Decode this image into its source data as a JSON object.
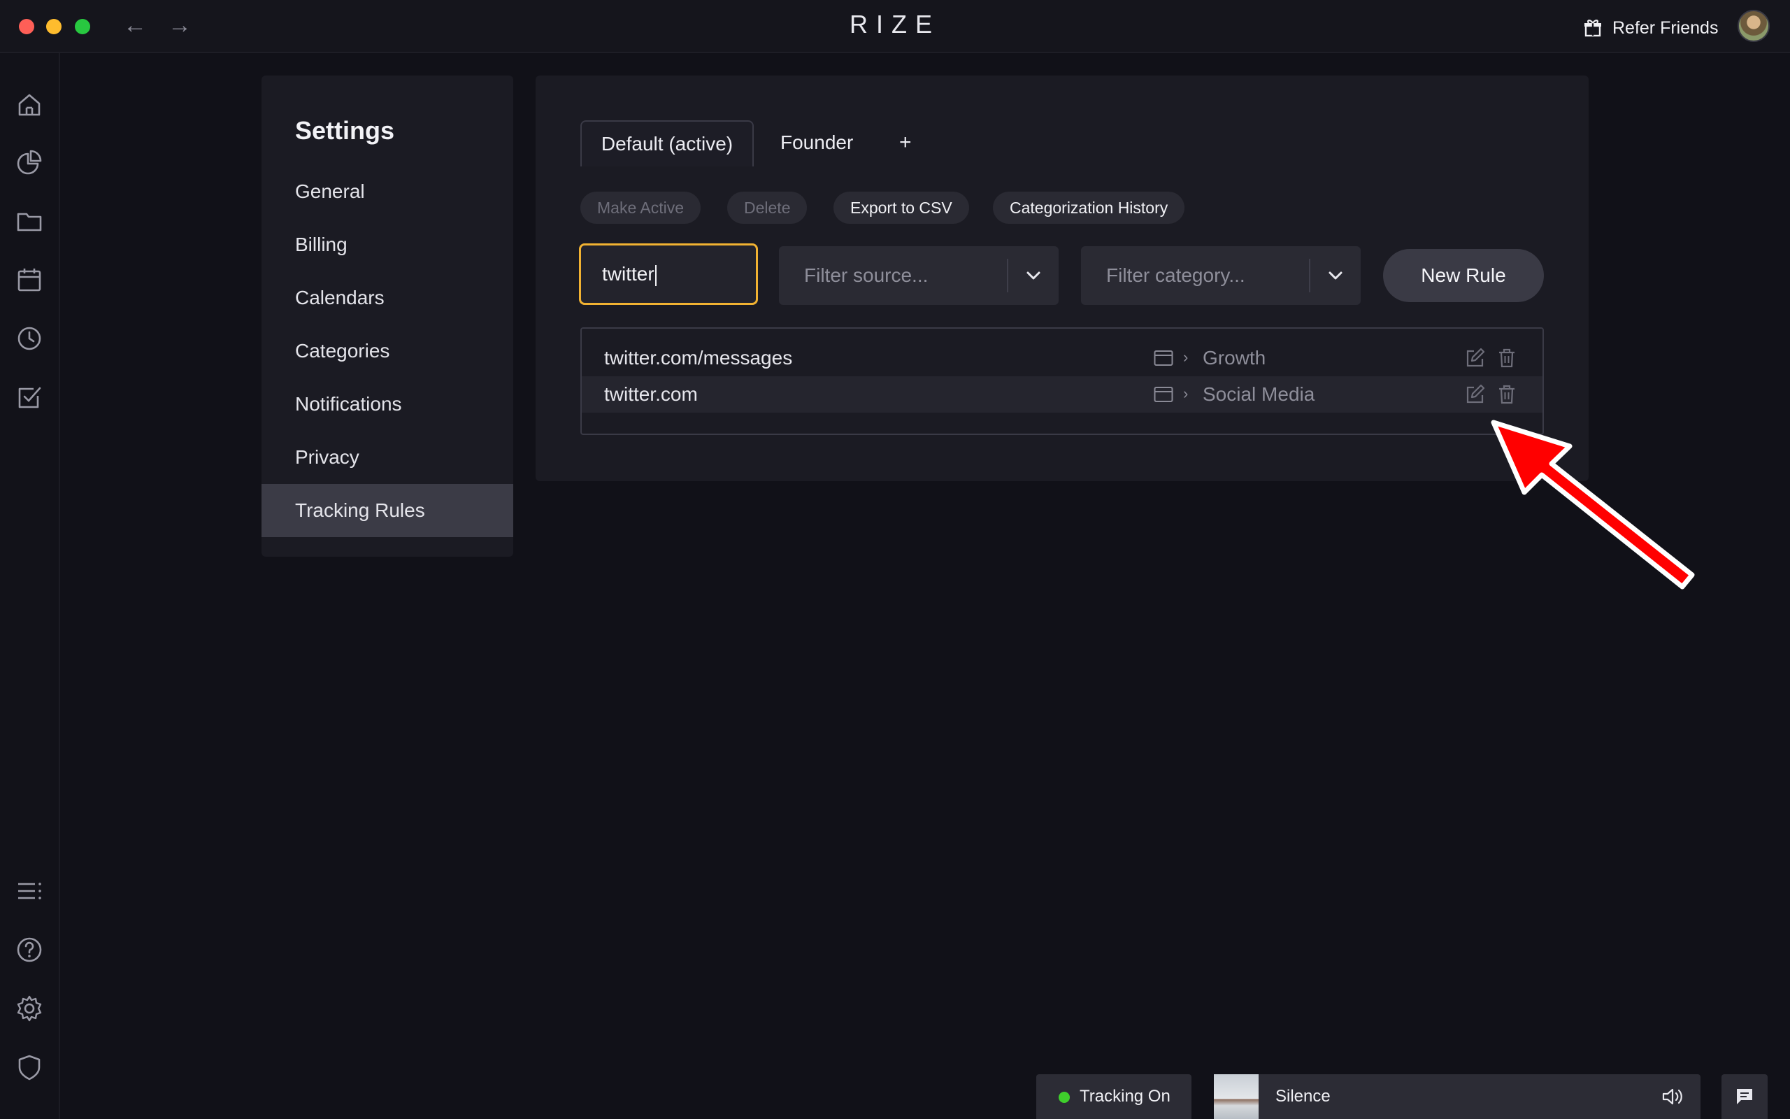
{
  "app": {
    "title": "RIZE"
  },
  "titlebar": {
    "refer_label": "Refer Friends"
  },
  "rail": {
    "top_icons": [
      "home-icon",
      "pie-chart-icon",
      "folder-icon",
      "calendar-icon",
      "clock-icon",
      "checkbox-icon"
    ],
    "bottom_icons": [
      "list-icon",
      "help-icon",
      "gear-icon",
      "shield-icon"
    ]
  },
  "settings": {
    "title": "Settings",
    "items": [
      {
        "label": "General"
      },
      {
        "label": "Billing"
      },
      {
        "label": "Calendars"
      },
      {
        "label": "Categories"
      },
      {
        "label": "Notifications"
      },
      {
        "label": "Privacy"
      },
      {
        "label": "Tracking Rules"
      }
    ],
    "active_item": "Tracking Rules"
  },
  "profiles": {
    "tabs": [
      {
        "label": "Default (active)"
      },
      {
        "label": "Founder"
      },
      {
        "label": "+"
      }
    ],
    "active_tab": "Default (active)"
  },
  "actions": {
    "make_active": "Make Active",
    "delete": "Delete",
    "export_csv": "Export to CSV",
    "history": "Categorization History"
  },
  "filters": {
    "search_value": "twitter",
    "source_placeholder": "Filter source...",
    "category_placeholder": "Filter category...",
    "new_rule": "New Rule"
  },
  "rules": [
    {
      "source": "twitter.com/messages",
      "separator": "›",
      "category": "Growth"
    },
    {
      "source": "twitter.com",
      "separator": "›",
      "category": "Social Media"
    }
  ],
  "bottom_bar": {
    "tracking_label": "Tracking On",
    "tracking_color": "#3fcf2c",
    "music_label": "Silence"
  },
  "colors": {
    "focus_ring": "#f1b232",
    "annotation_arrow": "#ff0000"
  }
}
